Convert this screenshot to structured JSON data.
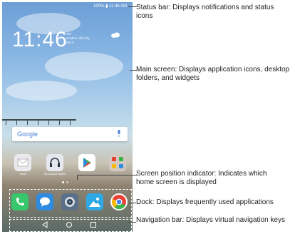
{
  "status_bar": {
    "text": "100% ▮ 11:46 AM"
  },
  "lock_clock": {
    "time": "11:46",
    "date": "AM\nSouth to sfsl Cty\nApr 5"
  },
  "search_widget": {
    "logo": "Google"
  },
  "home_apps": [
    {
      "label": "Email",
      "icon": "email-icon",
      "color": "#e9e9ee"
    },
    {
      "label": "My Account Hosted",
      "icon": "headphones-icon",
      "color": "#e7e7ef"
    },
    {
      "label": "",
      "icon": "play-store-icon",
      "color": "#ffffff"
    },
    {
      "label": "",
      "icon": "folder-icon",
      "color": "#d4c9c2"
    }
  ],
  "dock_apps": [
    {
      "icon": "phone-icon",
      "color": "#37c66b"
    },
    {
      "icon": "messages-icon",
      "color": "#2f8be0"
    },
    {
      "icon": "camera-icon",
      "color": "#5a6f88"
    },
    {
      "icon": "gallery-icon",
      "color": "#2fa8e6"
    },
    {
      "icon": "chrome-icon",
      "color": "#ffffff"
    }
  ],
  "callouts": {
    "status_bar": "Status bar: Displays notifications and status icons",
    "main_screen": "Main screen: Displays application icons, desktop folders, and widgets",
    "position_indicator": "Screen position indicator: Indicates which home screen is displayed",
    "dock": "Dock: Displays frequently used applications",
    "nav_bar": "Navigation bar: Displays virtual navigation keys"
  }
}
